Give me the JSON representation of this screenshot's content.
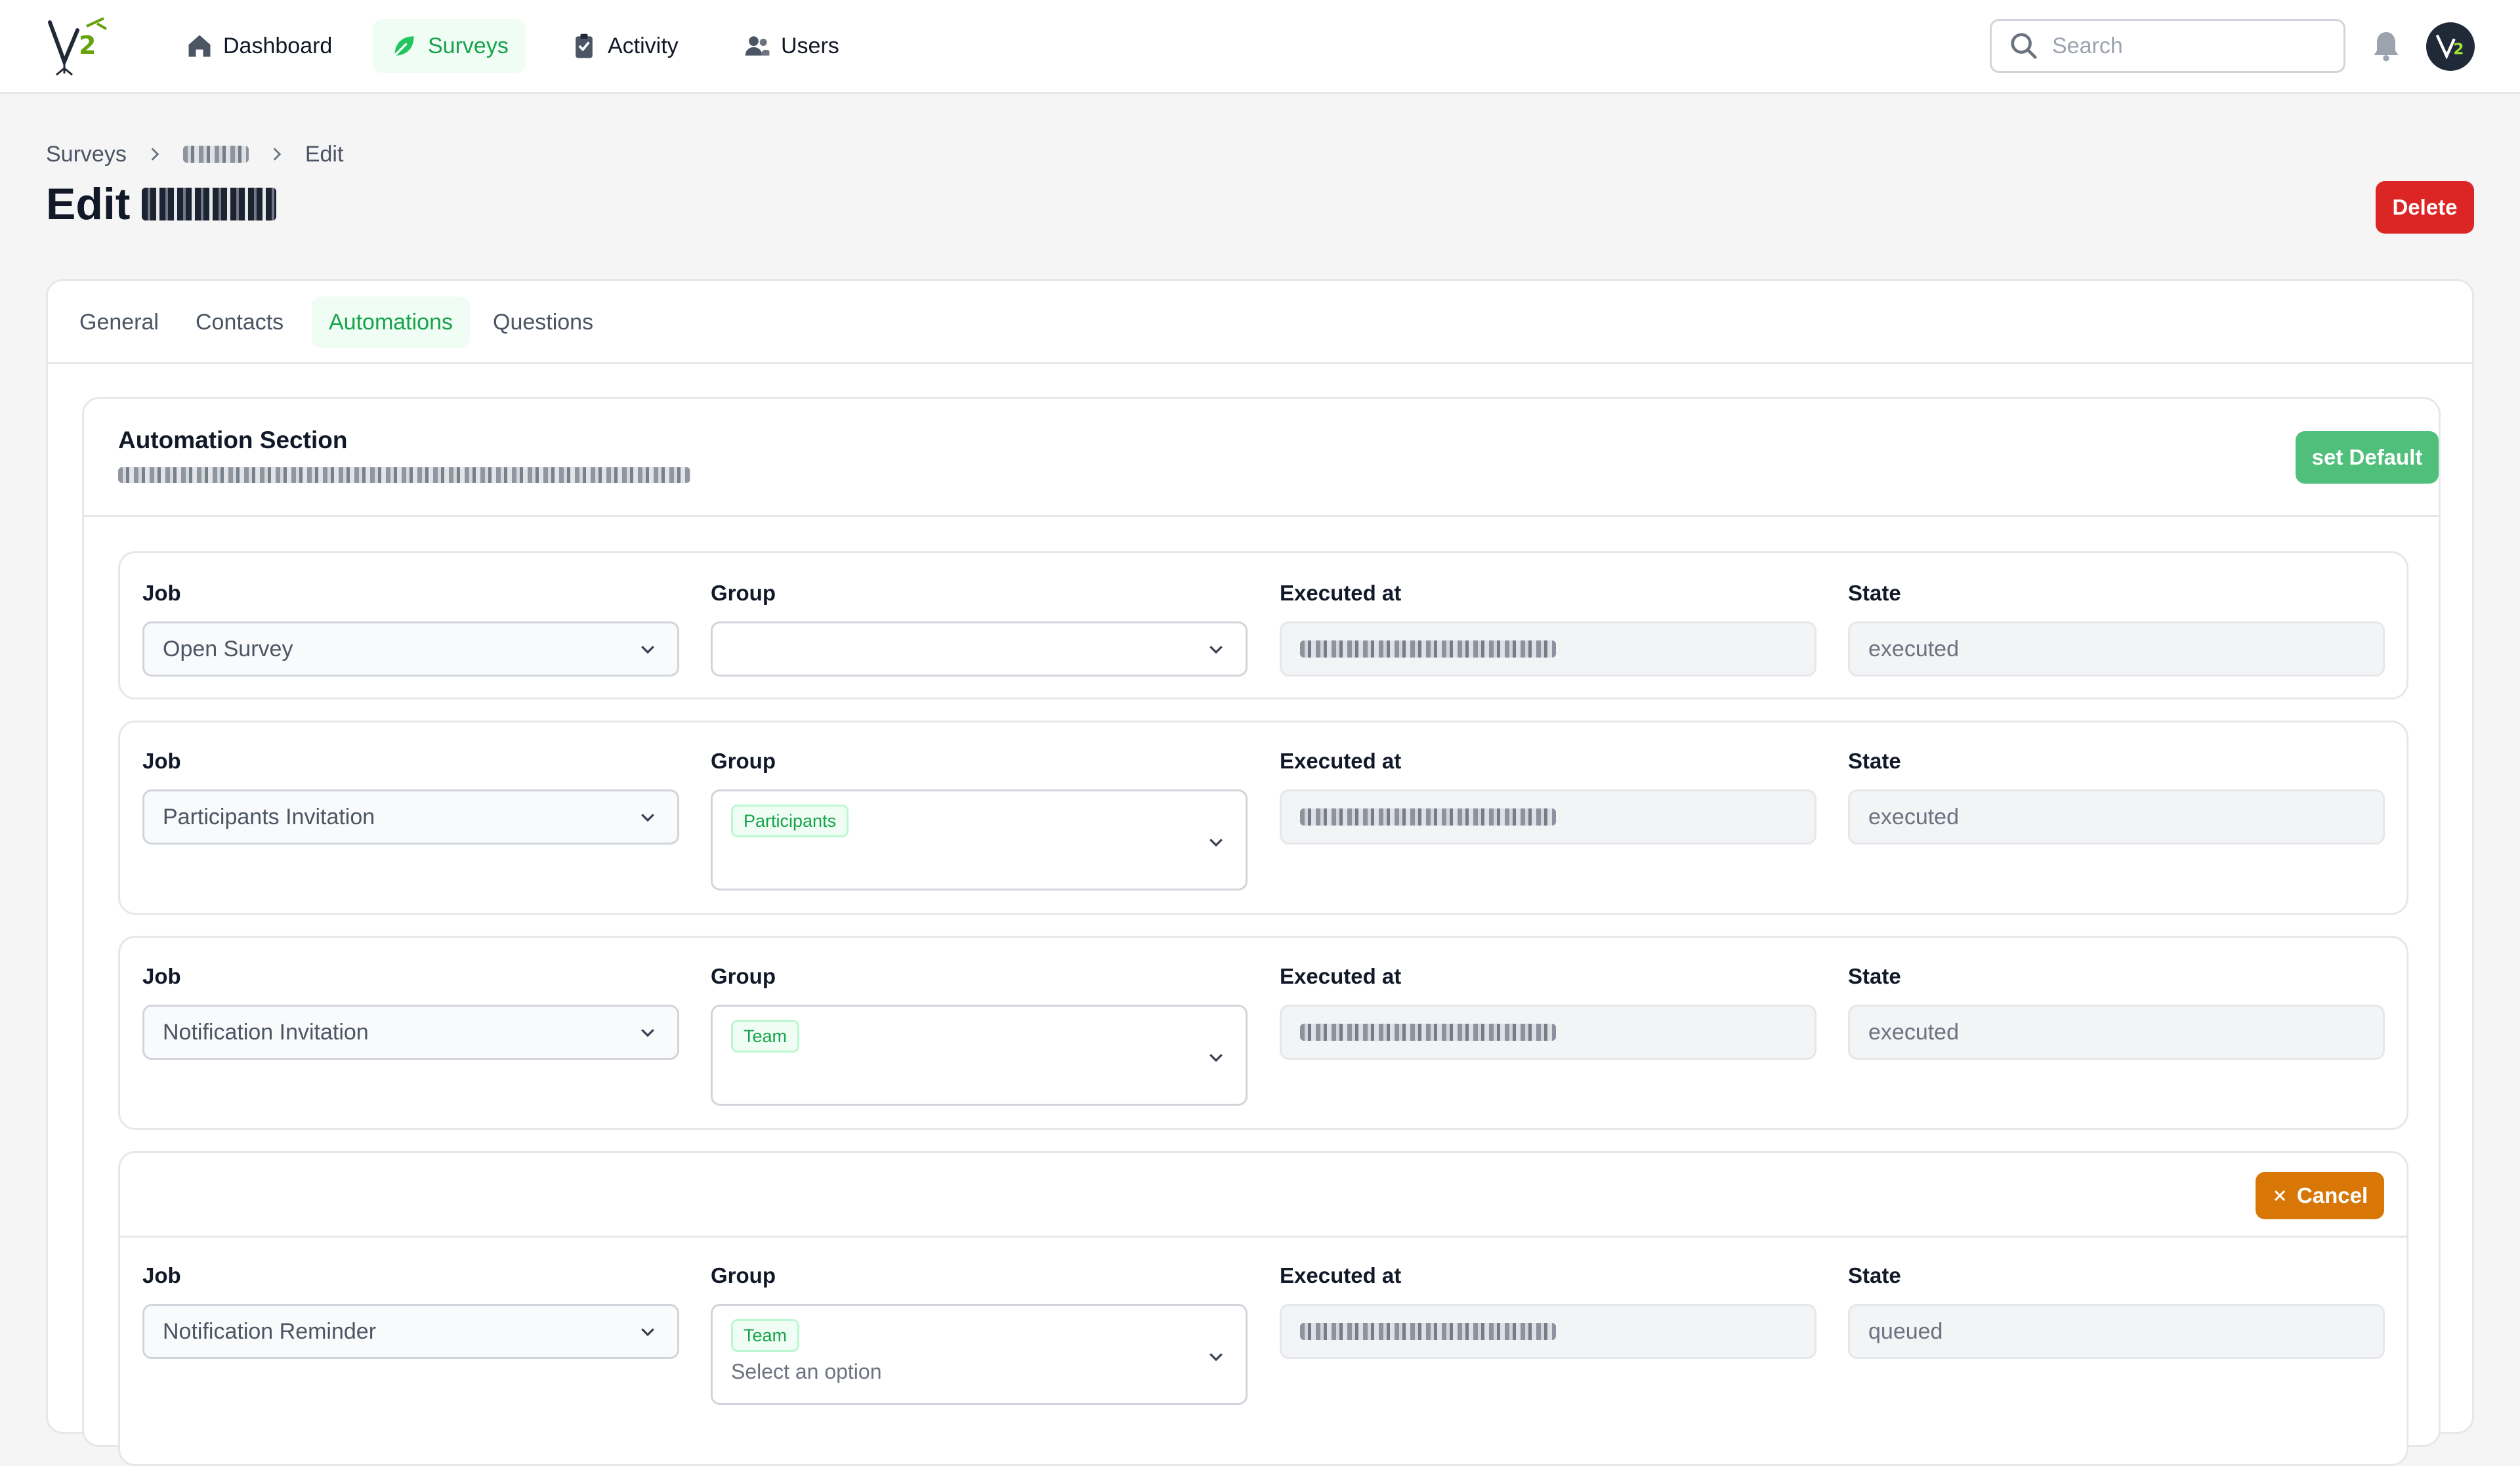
{
  "nav": {
    "items": [
      {
        "label": "Dashboard",
        "icon": "home-icon",
        "active": false
      },
      {
        "label": "Surveys",
        "icon": "leaf-icon",
        "active": true
      },
      {
        "label": "Activity",
        "icon": "clipboard-icon",
        "active": false
      },
      {
        "label": "Users",
        "icon": "users-icon",
        "active": false
      }
    ],
    "search_placeholder": "Search"
  },
  "breadcrumb": {
    "root": "Surveys",
    "current": "Edit"
  },
  "page": {
    "title_prefix": "Edit",
    "delete_label": "Delete"
  },
  "tabs": [
    {
      "label": "General",
      "active": false
    },
    {
      "label": "Contacts",
      "active": false
    },
    {
      "label": "Automations",
      "active": true
    },
    {
      "label": "Questions",
      "active": false
    }
  ],
  "automation": {
    "title": "Automation Section",
    "set_default_label": "set Default",
    "labels": {
      "job": "Job",
      "group": "Group",
      "executed_at": "Executed at",
      "state": "State"
    },
    "jobs": [
      {
        "job": "Open Survey",
        "group_tag": "",
        "state": "executed"
      },
      {
        "job": "Participants Invitation",
        "group_tag": "Participants",
        "state": "executed"
      },
      {
        "job": "Notification Invitation",
        "group_tag": "Team",
        "state": "executed"
      },
      {
        "job": "Notification Reminder",
        "group_tag": "Team",
        "group_placeholder": "Select an option",
        "state": "queued",
        "cancel_label": "Cancel"
      }
    ]
  },
  "colors": {
    "accent": "#16a34a",
    "danger": "#dc2626",
    "success_btn": "#4fbf7b",
    "warning": "#d97706"
  }
}
